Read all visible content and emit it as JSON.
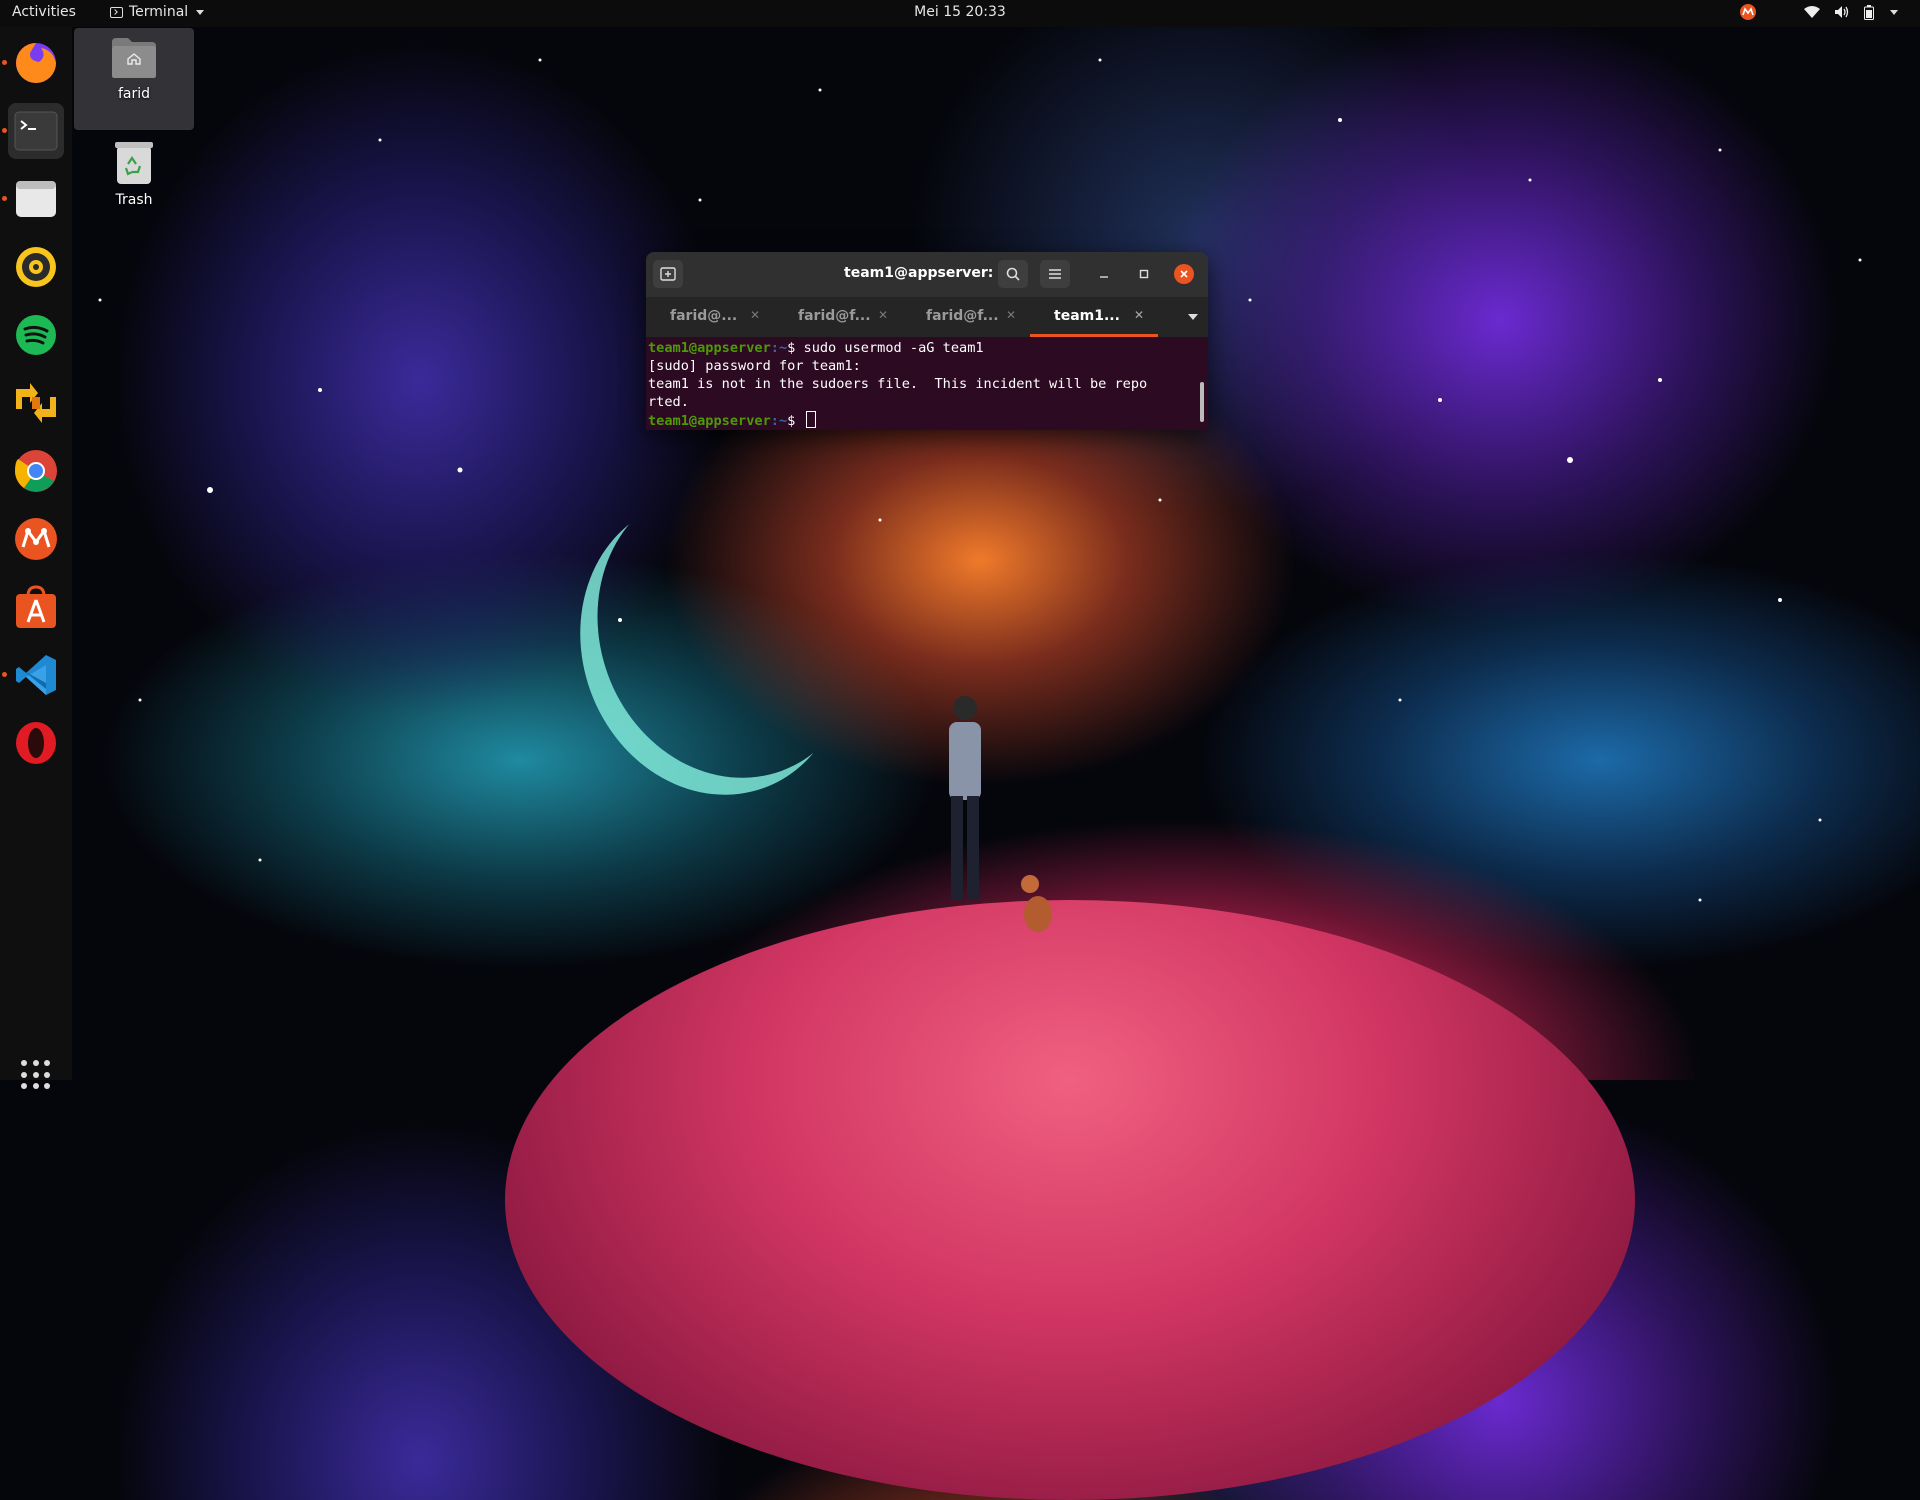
{
  "topbar": {
    "activities": "Activities",
    "app_menu": "Terminal",
    "clock": "Mei 15  20:33"
  },
  "dock": {
    "items": [
      {
        "name": "firefox",
        "running": true
      },
      {
        "name": "terminal",
        "running": true,
        "active": true
      },
      {
        "name": "files",
        "running": true
      },
      {
        "name": "rhythmbox",
        "running": false
      },
      {
        "name": "spotify",
        "running": false
      },
      {
        "name": "vym",
        "running": false
      },
      {
        "name": "chrome",
        "running": false
      },
      {
        "name": "ubuntu-mate",
        "running": false
      },
      {
        "name": "software-center",
        "running": false
      },
      {
        "name": "vscode",
        "running": true
      },
      {
        "name": "opera",
        "running": false
      }
    ]
  },
  "desktop": {
    "home_label": "farid",
    "trash_label": "Trash"
  },
  "terminal": {
    "title": "team1@appserver: ~",
    "tabs": [
      {
        "label": "farid@..."
      },
      {
        "label": "farid@f..."
      },
      {
        "label": "farid@f..."
      },
      {
        "label": "team1...",
        "active": true
      }
    ],
    "lines": {
      "l1_user": "team1@appserver",
      "l1_path": ":~",
      "l1_cmd": "$ sudo usermod -aG team1",
      "l2": "[sudo] password for team1:",
      "l3": "team1 is not in the sudoers file.  This incident will be repo",
      "l4": "rted.",
      "l5_user": "team1@appserver",
      "l5_path": ":~",
      "l5_cmd": "$ "
    }
  },
  "colors": {
    "accent": "#e95420",
    "terminal_bg": "#2c0a22",
    "prompt_user": "#4e9a06",
    "prompt_path": "#3465a4"
  }
}
